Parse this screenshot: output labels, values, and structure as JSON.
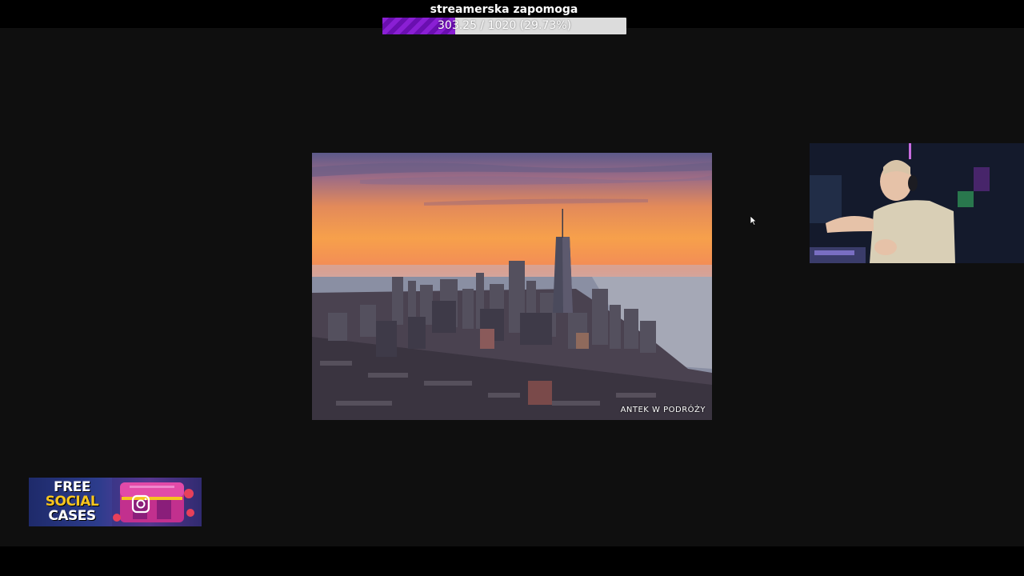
{
  "goal": {
    "title": "streamerska zapomoga",
    "progress_text": "303.25 / 1020 (29.73%)",
    "current": 303.25,
    "target": 1020,
    "percent": 29.73,
    "fill_color": "#8a1fd4",
    "track_color": "#dcdcdc"
  },
  "photo": {
    "watermark": "ANTEK W PODRÓŻY"
  },
  "promo": {
    "line1": "FREE",
    "line2": "SOCIAL",
    "line3": "CASES",
    "icon": "instagram-icon"
  },
  "colors": {
    "stage_background": "#0f0f0f",
    "frame_background": "#000000"
  }
}
